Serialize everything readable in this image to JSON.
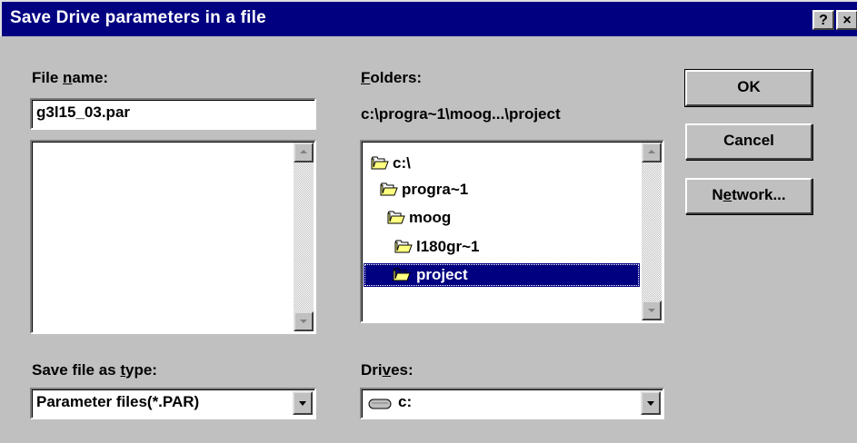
{
  "window": {
    "title": "Save Drive parameters in a file",
    "help_label": "?",
    "close_label": "×"
  },
  "file_name": {
    "label_pre": "File ",
    "label_u": "n",
    "label_post": "ame:",
    "value": "g3l15_03.par"
  },
  "folders": {
    "label_u": "F",
    "label_post": "olders:",
    "current_path": "c:\\progra~1\\moog...\\project",
    "items": [
      {
        "name": "c:\\",
        "selected": false
      },
      {
        "name": "progra~1",
        "selected": false
      },
      {
        "name": "moog",
        "selected": false
      },
      {
        "name": "l180gr~1",
        "selected": false
      },
      {
        "name": "project",
        "selected": true
      }
    ]
  },
  "save_type": {
    "label_pre": "Save file as ",
    "label_u": "t",
    "label_post": "ype:",
    "value": "Parameter files(*.PAR)"
  },
  "drives": {
    "label_pre": "Dri",
    "label_u": "v",
    "label_post": "es:",
    "value": "c:"
  },
  "buttons": {
    "ok": "OK",
    "cancel": "Cancel",
    "network_pre": "N",
    "network_u": "e",
    "network_post": "twork..."
  },
  "colors": {
    "face": "#c0c0c0",
    "titlebar": "#000080",
    "selection": "#000080",
    "folder": "#ffff80"
  }
}
